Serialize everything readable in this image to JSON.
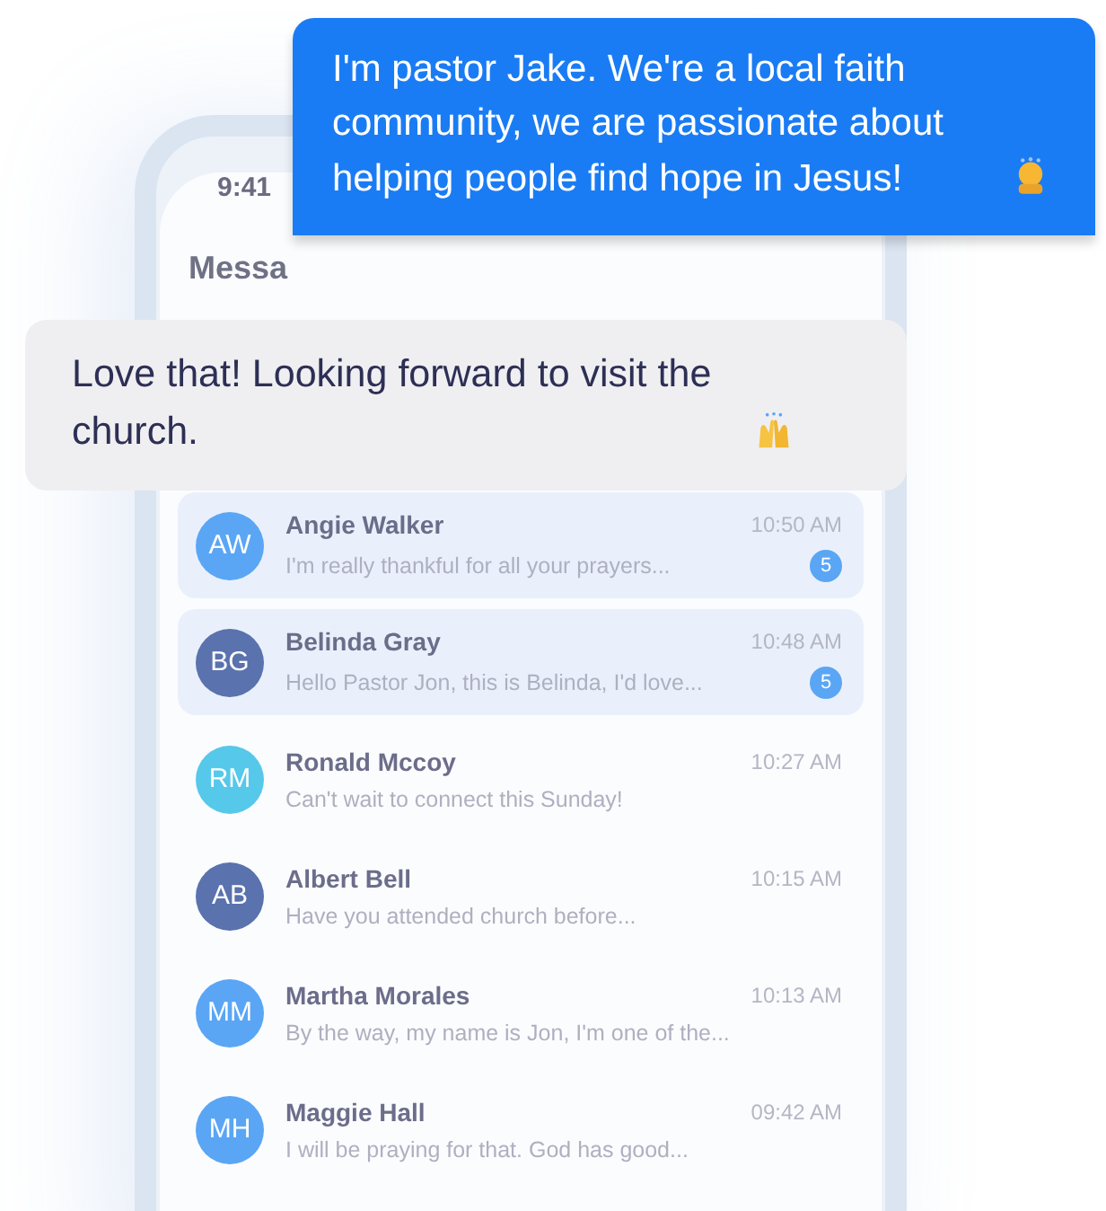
{
  "phone": {
    "status_time": "9:41",
    "header": "Messa"
  },
  "conversations": [
    {
      "initials": "AW",
      "name": "Angie Walker",
      "time": "10:50 AM",
      "preview": "I'm really thankful for all your prayers...",
      "unread": true,
      "badge": "5",
      "color": "#5aa6f5"
    },
    {
      "initials": "BG",
      "name": "Belinda Gray",
      "time": "10:48 AM",
      "preview": "Hello Pastor Jon, this is Belinda, I'd love...",
      "unread": true,
      "badge": "5",
      "color": "#5a72ad"
    },
    {
      "initials": "RM",
      "name": "Ronald Mccoy",
      "time": "10:27 AM",
      "preview": "Can't wait to connect this Sunday!",
      "unread": false,
      "color": "#56c8ea"
    },
    {
      "initials": "AB",
      "name": "Albert Bell",
      "time": "10:15 AM",
      "preview": "Have you attended church before...",
      "unread": false,
      "color": "#5a72ad"
    },
    {
      "initials": "MM",
      "name": "Martha Morales",
      "time": "10:13 AM",
      "preview": "By the way, my name is Jon, I'm one of the...",
      "unread": false,
      "color": "#5aa6f5"
    },
    {
      "initials": "MH",
      "name": "Maggie Hall",
      "time": "09:42 AM",
      "preview": "I will be praying for that. God has good...",
      "unread": false,
      "color": "#5aa6f5"
    }
  ],
  "bubbles": [
    {
      "kind": "outgoing",
      "text": "I'm pastor Jake. We're a local faith community, we are passionate about helping people find hope in Jesus!"
    },
    {
      "kind": "incoming",
      "text": "Love that! Looking forward to visit the church."
    }
  ]
}
